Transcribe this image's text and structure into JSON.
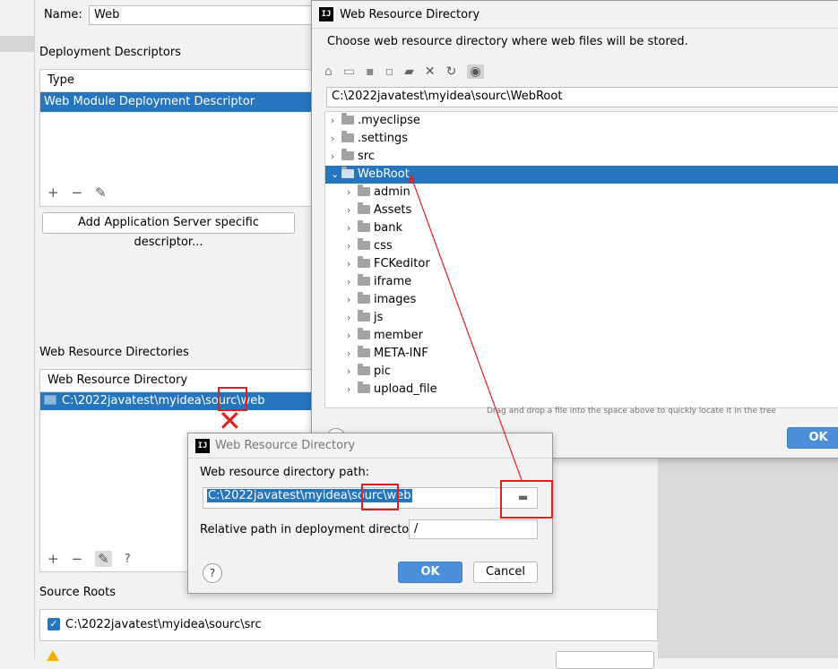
{
  "name_field": {
    "label": "Name:",
    "value": "Web"
  },
  "deployment": {
    "section_title": "Deployment Descriptors",
    "column_header": "Type",
    "rows": [
      "Web Module Deployment Descriptor"
    ],
    "add_server_button": "Add Application Server specific descriptor..."
  },
  "web_resource": {
    "section_title": "Web Resource Directories",
    "column_header": "Web Resource Directory",
    "rows": [
      "C:\\2022javatest\\myidea\\sourc\\web"
    ]
  },
  "source_roots": {
    "section_title": "Source Roots",
    "item": "C:\\2022javatest\\myidea\\sourc\\src",
    "checked": true
  },
  "toolbar": {
    "add": "+",
    "remove": "−",
    "edit": "✎",
    "help": "?"
  },
  "chooser": {
    "title": "Web Resource Directory",
    "description": "Choose web resource directory where web files will be stored.",
    "path": "C:\\2022javatest\\myidea\\sourc\\WebRoot",
    "hint": "Drag and drop a file into the space above to quickly locate it in the tree",
    "ok_label": "OK",
    "tree_top": [
      ".myeclipse",
      ".settings",
      "src"
    ],
    "selected": "WebRoot",
    "children": [
      "admin",
      "Assets",
      "bank",
      "css",
      "FCKeditor",
      "iframe",
      "images",
      "js",
      "member",
      "META-INF",
      "pic",
      "upload_file"
    ]
  },
  "edit_dialog": {
    "title": "Web Resource Directory",
    "path_label": "Web resource directory path:",
    "path_value": "C:\\2022javatest\\myidea\\sourc\\web",
    "relative_label": "Relative path in deployment directory:",
    "relative_value": "/",
    "ok_label": "OK",
    "cancel_label": "Cancel"
  },
  "colors": {
    "selection": "#2675bf",
    "primary_button": "#4a8fd7",
    "annotation_red": "#e21f1f"
  }
}
